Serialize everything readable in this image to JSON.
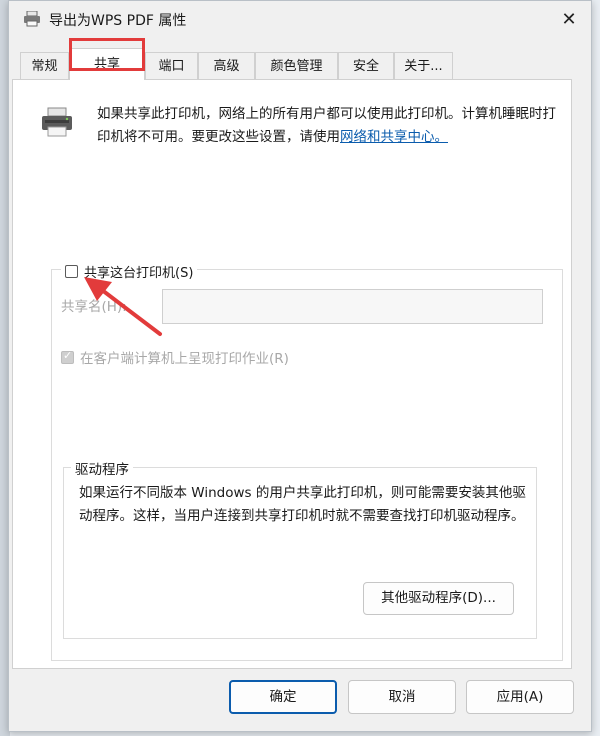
{
  "window": {
    "title": "导出为WPS PDF 属性",
    "close_symbol": "✕"
  },
  "tabs": [
    {
      "label": "常规"
    },
    {
      "label": "共享"
    },
    {
      "label": "端口"
    },
    {
      "label": "高级"
    },
    {
      "label": "颜色管理"
    },
    {
      "label": "安全"
    },
    {
      "label": "关于..."
    }
  ],
  "active_tab": "共享",
  "info": {
    "text": "如果共享此打印机，网络上的所有用户都可以使用此打印机。计算机睡眠时打印机将不可用。要更改这些设置，请使用",
    "link": "网络和共享中心。"
  },
  "share": {
    "checkbox_label": "共享这台打印机(S)",
    "checked": false,
    "name_label": "共享名(H):",
    "name_value": "",
    "render_label": "在客户端计算机上呈现打印作业(R)",
    "render_checked": true
  },
  "drivers": {
    "legend": "驱动程序",
    "text": "如果运行不同版本 Windows 的用户共享此打印机，则可能需要安装其他驱动程序。这样，当用户连接到共享打印机时就不需要查找打印机驱动程序。",
    "button": "其他驱动程序(D)..."
  },
  "footer": {
    "ok": "确定",
    "cancel": "取消",
    "apply": "应用(A)"
  },
  "colors": {
    "highlight": "#e23b3b",
    "link": "#0b5cad",
    "annotation_arrow": "#e23b3b"
  }
}
